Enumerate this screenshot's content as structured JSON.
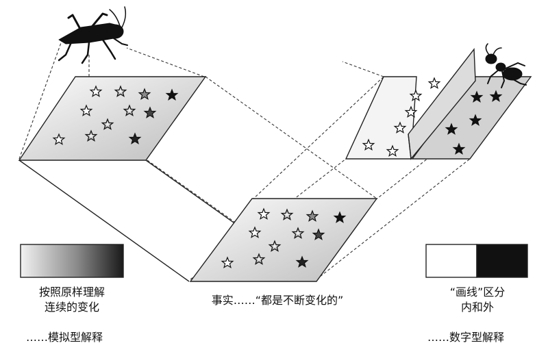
{
  "labels": {
    "analog_caption_line1": "按照原样理解",
    "analog_caption_line2": "连续的变化",
    "analog_legend": "……模拟型解释",
    "fact_caption": "事实……“都是不断变化的”",
    "digital_caption_line1": "“画线”区分",
    "digital_caption_line2": "内和外",
    "digital_legend": "……数字型解释"
  },
  "icons": {
    "analog_view_icon": "grasshopper-icon",
    "digital_view_icon": "ant-icon",
    "star_icon": "star-icon"
  },
  "colors": {
    "ink": "#111111",
    "gradient_light": "#f2f2f2",
    "gradient_dark": "#1a1a1a",
    "binary_white": "#ffffff",
    "binary_black": "#111111"
  }
}
